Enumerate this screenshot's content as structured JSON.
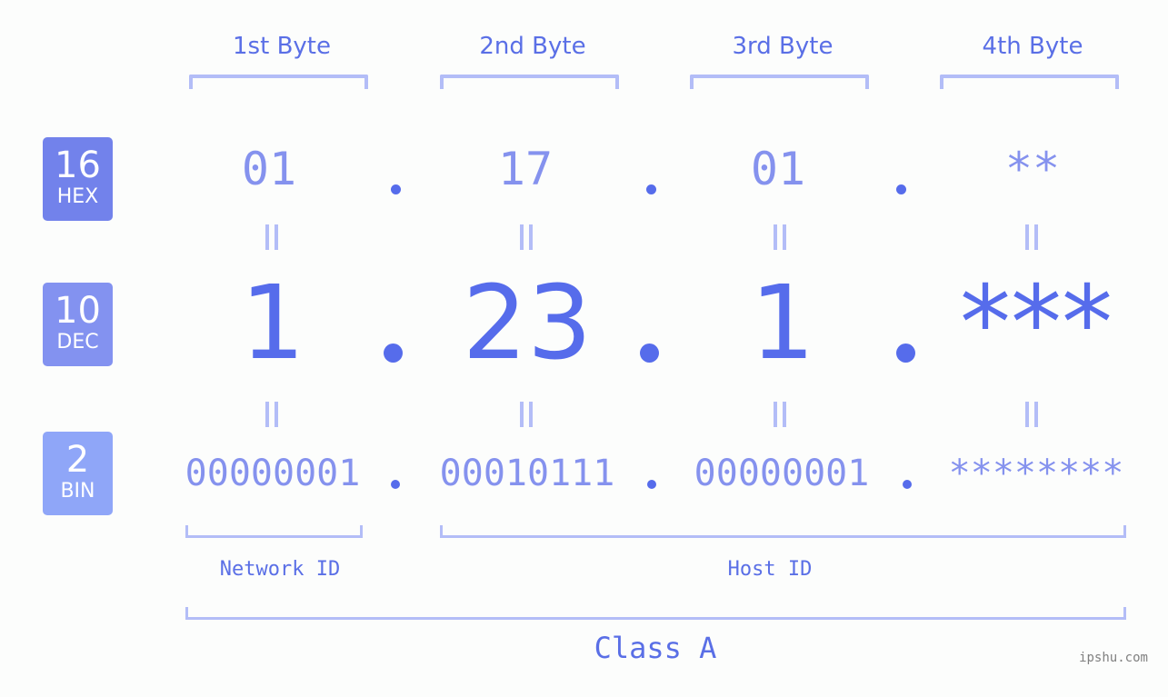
{
  "bytes": {
    "headers": [
      "1st Byte",
      "2nd Byte",
      "3rd Byte",
      "4th Byte"
    ],
    "hex": [
      "01",
      "17",
      "01",
      "**"
    ],
    "dec": [
      "1",
      "23",
      "1",
      "***"
    ],
    "bin": [
      "00000001",
      "00010111",
      "00000001",
      "********"
    ]
  },
  "badges": {
    "hex": {
      "num": "16",
      "label": "HEX",
      "color": "#7282eb"
    },
    "dec": {
      "num": "10",
      "label": "DEC",
      "color": "#8392f0"
    },
    "bin": {
      "num": "2",
      "label": "BIN",
      "color": "#8fa6f8"
    }
  },
  "labels": {
    "network_id": "Network ID",
    "host_id": "Host ID",
    "ip_class": "Class A"
  },
  "watermark": "ipshu.com",
  "colors": {
    "accent": "#566ceb",
    "light_accent": "#8592ee",
    "bracket": "#b3bdf7"
  }
}
